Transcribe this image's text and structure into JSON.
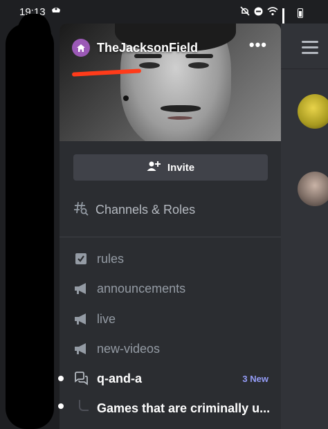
{
  "status_bar": {
    "time": "19:13"
  },
  "server": {
    "name": "TheJacksonField",
    "menu_label": "•••"
  },
  "actions": {
    "invite_label": "Invite",
    "channels_roles_label": "Channels & Roles"
  },
  "channels": [
    {
      "name": "rules",
      "icon": "rules-icon",
      "unread": false
    },
    {
      "name": "announcements",
      "icon": "megaphone-icon",
      "unread": false
    },
    {
      "name": "live",
      "icon": "megaphone-icon",
      "unread": false
    },
    {
      "name": "new-videos",
      "icon": "megaphone-icon",
      "unread": false
    },
    {
      "name": "q-and-a",
      "icon": "forum-icon",
      "unread": true,
      "badge": "3 New"
    },
    {
      "name": "Games that are criminally u...",
      "icon": "thread-line",
      "unread": true
    }
  ],
  "colors": {
    "background": "#1e1f22",
    "panel": "#2b2d31",
    "accent": "#5865f2",
    "new_badge": "#949cf7",
    "server_badge": "#9b59b6",
    "annotation": "#ff3b1a"
  }
}
